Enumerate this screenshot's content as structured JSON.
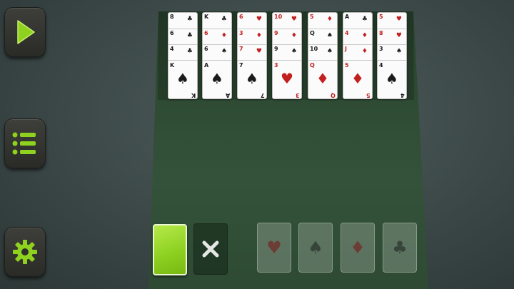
{
  "sidebar": {
    "buttons": [
      {
        "id": "play",
        "icon": "play-icon"
      },
      {
        "id": "menu",
        "icon": "menu-icon"
      },
      {
        "id": "settings",
        "icon": "gear-icon"
      }
    ],
    "accent": "#8fd11f"
  },
  "table": {
    "felt_color": "#2f4a32",
    "columns": [
      {
        "cards": [
          {
            "rank": "8",
            "suit": "♣",
            "color": "black"
          },
          {
            "rank": "6",
            "suit": "♣",
            "color": "black"
          },
          {
            "rank": "4",
            "suit": "♣",
            "color": "black"
          },
          {
            "rank": "K",
            "suit": "♠",
            "color": "black"
          }
        ]
      },
      {
        "cards": [
          {
            "rank": "K",
            "suit": "♣",
            "color": "black"
          },
          {
            "rank": "6",
            "suit": "♦",
            "color": "red"
          },
          {
            "rank": "6",
            "suit": "♠",
            "color": "black"
          },
          {
            "rank": "A",
            "suit": "♠",
            "color": "black"
          }
        ]
      },
      {
        "cards": [
          {
            "rank": "6",
            "suit": "♥",
            "color": "red"
          },
          {
            "rank": "3",
            "suit": "♦",
            "color": "red"
          },
          {
            "rank": "7",
            "suit": "♥",
            "color": "red"
          },
          {
            "rank": "7",
            "suit": "♠",
            "color": "black"
          }
        ]
      },
      {
        "cards": [
          {
            "rank": "10",
            "suit": "♥",
            "color": "red"
          },
          {
            "rank": "9",
            "suit": "♦",
            "color": "red"
          },
          {
            "rank": "9",
            "suit": "♠",
            "color": "black"
          },
          {
            "rank": "3",
            "suit": "♥",
            "color": "red"
          }
        ]
      },
      {
        "cards": [
          {
            "rank": "5",
            "suit": "♦",
            "color": "red"
          },
          {
            "rank": "Q",
            "suit": "♠",
            "color": "black"
          },
          {
            "rank": "10",
            "suit": "♠",
            "color": "black"
          },
          {
            "rank": "Q",
            "suit": "♦",
            "color": "red"
          }
        ]
      },
      {
        "cards": [
          {
            "rank": "A",
            "suit": "♣",
            "color": "black"
          },
          {
            "rank": "4",
            "suit": "♦",
            "color": "red"
          },
          {
            "rank": "J",
            "suit": "♦",
            "color": "red"
          },
          {
            "rank": "5",
            "suit": "♦",
            "color": "red"
          }
        ]
      },
      {
        "cards": [
          {
            "rank": "5",
            "suit": "♥",
            "color": "red"
          },
          {
            "rank": "8",
            "suit": "♥",
            "color": "red"
          },
          {
            "rank": "3",
            "suit": "♠",
            "color": "black"
          },
          {
            "rank": "4",
            "suit": "♠",
            "color": "black"
          }
        ]
      }
    ]
  },
  "piles": {
    "stock": {
      "back_color": "#8ccf1f"
    },
    "waste": {
      "icon": "close-icon"
    },
    "foundations": [
      {
        "suit": "♥",
        "kind": "heart"
      },
      {
        "suit": "♠",
        "kind": "spade"
      },
      {
        "suit": "♦",
        "kind": "diamond"
      },
      {
        "suit": "♣",
        "kind": "club"
      }
    ]
  }
}
